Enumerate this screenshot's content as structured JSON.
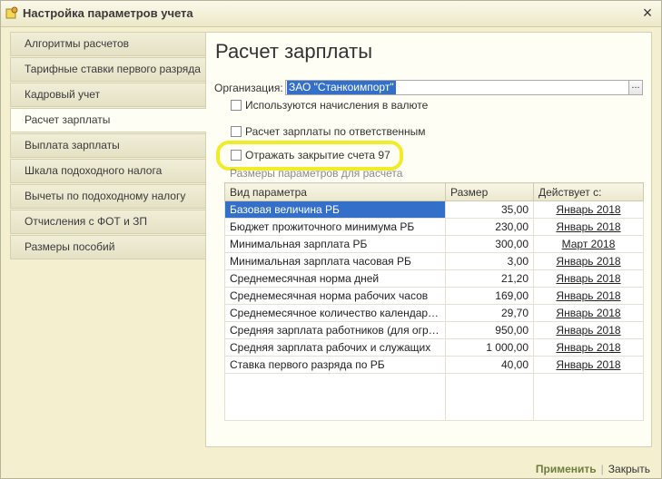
{
  "window": {
    "title": "Настройка параметров учета",
    "close_icon": "close-icon"
  },
  "nav": {
    "items": [
      {
        "label": "Алгоритмы расчетов"
      },
      {
        "label": "Тарифные ставки первого разряда"
      },
      {
        "label": "Кадровый учет"
      },
      {
        "label": "Расчет зарплаты",
        "active": true
      },
      {
        "label": "Выплата зарплаты"
      },
      {
        "label": "Шкала подоходного налога"
      },
      {
        "label": "Вычеты по подоходному налогу"
      },
      {
        "label": "Отчисления с ФОТ и ЗП"
      },
      {
        "label": "Размеры пособий"
      }
    ]
  },
  "main": {
    "title": "Расчет зарплаты",
    "org_label": "Организация:",
    "org_value": "ЗАО \"Станкоимпорт\"",
    "org_button": "...",
    "checkboxes": [
      {
        "label": "Используются начисления в валюте",
        "checked": false
      },
      {
        "label": "Расчет зарплаты по ответственным",
        "checked": false
      },
      {
        "label": "Отражать закрытие счета 97",
        "checked": false
      }
    ],
    "group_title": "Размеры параметров для расчета",
    "table": {
      "columns": [
        "Вид параметра",
        "Размер",
        "Действует с:"
      ],
      "rows": [
        {
          "name": "Базовая величина РБ",
          "value": "35,00",
          "date": "Январь 2018"
        },
        {
          "name": "Бюджет прожиточного минимума РБ",
          "value": "230,00",
          "date": "Январь 2018"
        },
        {
          "name": "Минимальная зарплата РБ",
          "value": "300,00",
          "date": "Март 2018"
        },
        {
          "name": "Минимальная зарплата часовая РБ",
          "value": "3,00",
          "date": "Январь 2018"
        },
        {
          "name": "Среднемесячная норма дней",
          "value": "21,20",
          "date": "Январь 2018"
        },
        {
          "name": "Среднемесячная норма рабочих часов",
          "value": "169,00",
          "date": "Январь 2018"
        },
        {
          "name": "Среднемесячное количество календарных д...",
          "value": "29,70",
          "date": "Январь 2018"
        },
        {
          "name": "Средняя зарплата работников (для огранич...",
          "value": "950,00",
          "date": "Январь 2018"
        },
        {
          "name": "Средняя зарплата рабочих и служащих",
          "value": "1 000,00",
          "date": "Январь 2018"
        },
        {
          "name": "Ставка первого разряда по РБ",
          "value": "40,00",
          "date": "Январь 2018"
        }
      ]
    }
  },
  "footer": {
    "apply": "Применить",
    "separator": "|",
    "close": "Закрыть"
  },
  "colors": {
    "selection": "#3470c9",
    "highlight": "#f0ec2a",
    "background": "#f4f0cf"
  }
}
